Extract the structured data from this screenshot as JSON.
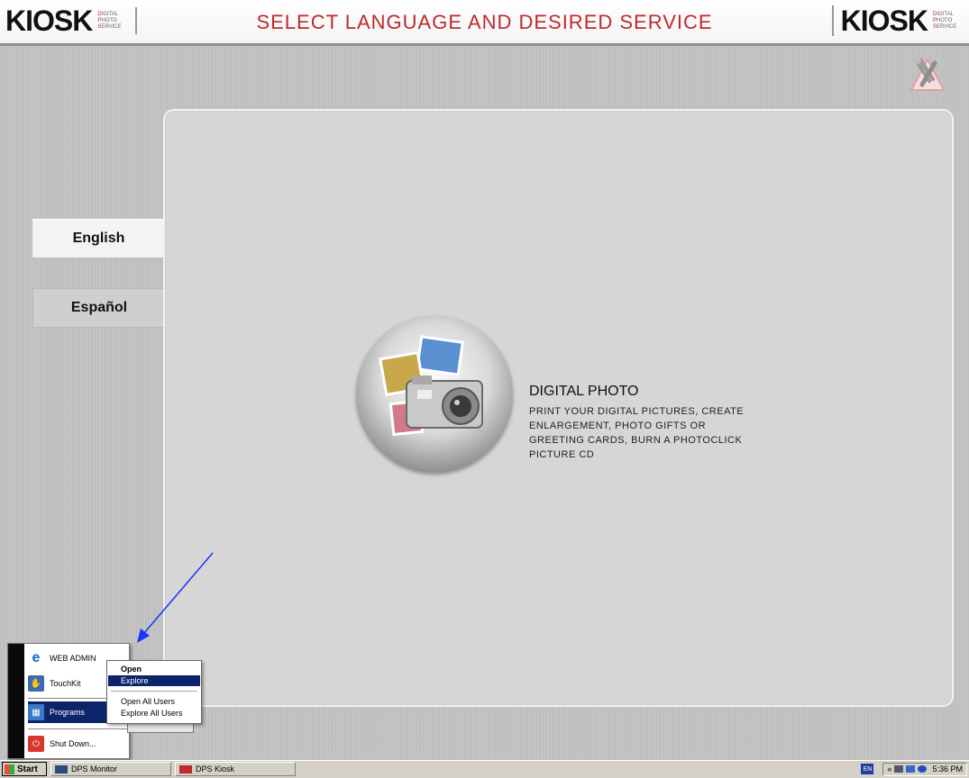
{
  "header": {
    "title": "SELECT LANGUAGE AND DESIRED SERVICE",
    "logo_text": "KIOSK",
    "logo_subtitle": [
      "DIGITAL",
      "PHOTO",
      "SERVICE"
    ],
    "accent_color": "#c0292b"
  },
  "languages": [
    {
      "label": "English",
      "selected": true
    },
    {
      "label": "Español",
      "selected": false
    }
  ],
  "service": {
    "title": "DIGITAL PHOTO",
    "description": "PRINT YOUR DIGITAL PICTURES, CREATE ENLARGEMENT, PHOTO GIFTS OR GREETING CARDS, BURN A PHOTOCLICK PICTURE CD",
    "icon": "digital-camera-icon"
  },
  "start_menu": {
    "items": [
      {
        "label": "WEB ADMIN",
        "icon": "internet-explorer-icon"
      },
      {
        "label": "TouchKit",
        "icon": "touchkit-icon"
      },
      {
        "label": "Programs",
        "icon": "programs-icon",
        "selected": true
      },
      {
        "label": "Shut Down...",
        "icon": "shutdown-icon"
      }
    ]
  },
  "context_menu": {
    "items": [
      {
        "label": "Open",
        "bold": true
      },
      {
        "label": "Explore",
        "selected": true
      },
      {
        "label": "Open All Users"
      },
      {
        "label": "Explore All Users"
      }
    ]
  },
  "taskbar": {
    "start_label": "Start",
    "tasks": [
      "DPS Monitor",
      "DPS Kiosk"
    ],
    "language_indicator": "EN",
    "clock": "5:36 PM"
  }
}
